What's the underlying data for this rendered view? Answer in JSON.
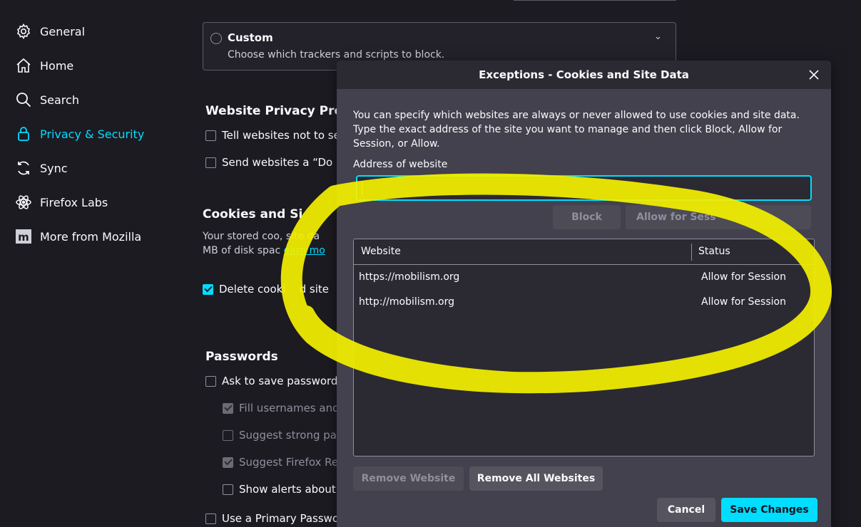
{
  "sidebar": {
    "items": [
      {
        "label": "General",
        "icon": "gear-icon"
      },
      {
        "label": "Home",
        "icon": "home-icon"
      },
      {
        "label": "Search",
        "icon": "search-icon"
      },
      {
        "label": "Privacy & Security",
        "icon": "lock-icon",
        "active": true
      },
      {
        "label": "Sync",
        "icon": "sync-icon"
      },
      {
        "label": "Firefox Labs",
        "icon": "labs-icon"
      },
      {
        "label": "More from Mozilla",
        "icon": "mozilla-icon"
      }
    ]
  },
  "main": {
    "custom": {
      "title": "Custom",
      "desc": "Choose which trackers and scripts to block."
    },
    "privacy_prefs": {
      "title": "Website Privacy Prefe",
      "tell_sites": "Tell websites not to sel",
      "send_dnt": "Send websites a “Do N"
    },
    "cookies": {
      "title": "Cookies and Si",
      "line1": "Your stored coo",
      "line1b": ", site da",
      "line2": "MB of disk spac",
      "link": "earn mo",
      "delete": "Delete cooki",
      "delete_b": "d site"
    },
    "passwords": {
      "title": "Passwords",
      "ask_save": "Ask to save passwords",
      "fill": "Fill usernames and",
      "suggest_strong": "Suggest strong pas",
      "suggest_relay": "Suggest Firefox Rel",
      "show_alerts": "Show alerts about p",
      "primary": "Use a Primary Passwor"
    }
  },
  "dialog": {
    "title": "Exceptions - Cookies and Site Data",
    "description": "You can specify which websites are always or never allowed to use cookies and site data. Type the exact address of the site you want to manage and then click Block, Allow for Session, or Allow.",
    "address_label": "Address of website",
    "address_value": "",
    "buttons": {
      "block": "Block",
      "allow_session": "Allow for Sess"
    },
    "table": {
      "columns": [
        "Website",
        "Status"
      ],
      "rows": [
        {
          "website": "https://mobilism.org",
          "status": "Allow for Session"
        },
        {
          "website": "http://mobilism.org",
          "status": "Allow for Session"
        }
      ]
    },
    "remove_website": "Remove Website",
    "remove_all": "Remove All Websites",
    "cancel": "Cancel",
    "save": "Save Changes"
  },
  "colors": {
    "accent": "#00ddff",
    "background": "#1c1b22",
    "dialog": "#42414d",
    "highlighter": "#ffff00"
  }
}
